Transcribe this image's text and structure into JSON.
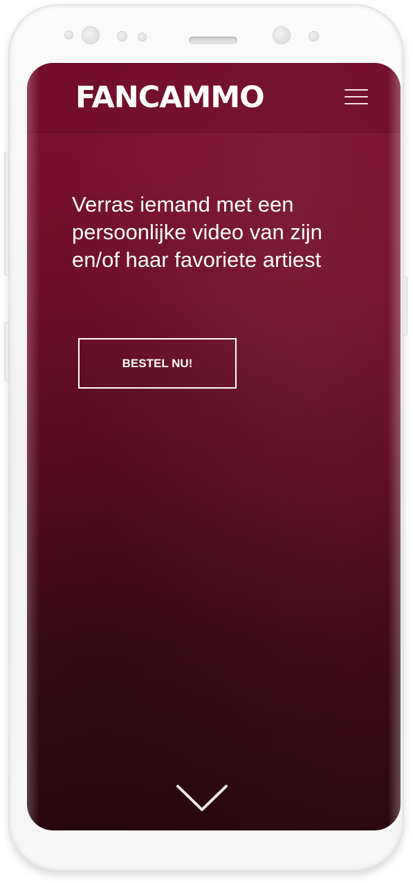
{
  "header": {
    "logo_text": "FANCAMMO",
    "menu_icon": "hamburger-menu-icon"
  },
  "hero": {
    "headline": "Verras iemand met een persoonlijke video van zijn en/of haar favoriete artiest",
    "cta_label": "BESTEL NU!",
    "scroll_icon": "chevron-down-icon"
  },
  "colors": {
    "background": "#730f2c",
    "background_dark": "#2c0811",
    "text": "#ffffff"
  }
}
